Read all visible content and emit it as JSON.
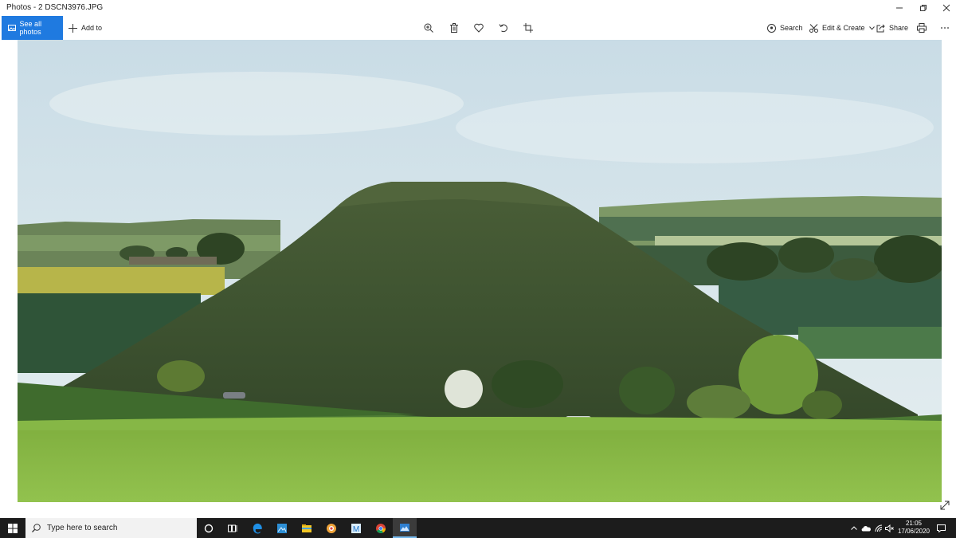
{
  "window": {
    "title": "Photos - 2 DSCN3976.JPG"
  },
  "commandbar": {
    "see_all_label": "See all photos",
    "add_to_label": "Add to",
    "search_label": "Search",
    "edit_create_label": "Edit & Create",
    "share_label": "Share",
    "center_icons": [
      "zoom-icon",
      "delete-icon",
      "favorite-heart-icon",
      "rotate-icon",
      "crop-icon"
    ],
    "accent_color": "#1f7ae0"
  },
  "photo": {
    "subject": "green grassy conical hill with fields and trees"
  },
  "taskbar": {
    "search_placeholder": "Type here to search",
    "apps": [
      "task-view-icon",
      "edge-icon",
      "photos-app-icon",
      "file-explorer-icon",
      "app-icon",
      "mail-icon",
      "chrome-icon",
      "photos-viewer-icon"
    ],
    "time": "21:05",
    "date": "17/06/2020"
  }
}
